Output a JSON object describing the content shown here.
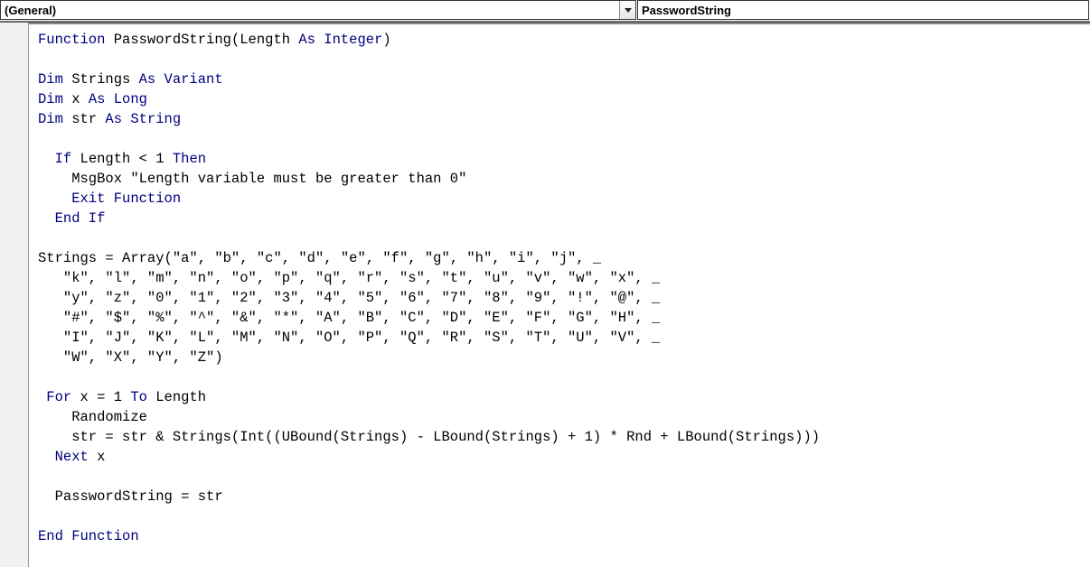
{
  "dropdowns": {
    "object": "(General)",
    "procedure": "PasswordString"
  },
  "code": {
    "l01a": "Function",
    "l01b": " PasswordString(Length ",
    "l01c": "As Integer",
    "l01d": ")",
    "l03a": "Dim",
    "l03b": " Strings ",
    "l03c": "As Variant",
    "l04a": "Dim",
    "l04b": " x ",
    "l04c": "As Long",
    "l05a": "Dim",
    "l05b": " str ",
    "l05c": "As String",
    "l07a": "  If",
    "l07b": " Length < 1 ",
    "l07c": "Then",
    "l08": "    MsgBox \"Length variable must be greater than 0\"",
    "l09": "    Exit Function",
    "l10": "  End If",
    "l12": "Strings = Array(\"a\", \"b\", \"c\", \"d\", \"e\", \"f\", \"g\", \"h\", \"i\", \"j\", _",
    "l13": "   \"k\", \"l\", \"m\", \"n\", \"o\", \"p\", \"q\", \"r\", \"s\", \"t\", \"u\", \"v\", \"w\", \"x\", _",
    "l14": "   \"y\", \"z\", \"0\", \"1\", \"2\", \"3\", \"4\", \"5\", \"6\", \"7\", \"8\", \"9\", \"!\", \"@\", _",
    "l15": "   \"#\", \"$\", \"%\", \"^\", \"&\", \"*\", \"A\", \"B\", \"C\", \"D\", \"E\", \"F\", \"G\", \"H\", _",
    "l16": "   \"I\", \"J\", \"K\", \"L\", \"M\", \"N\", \"O\", \"P\", \"Q\", \"R\", \"S\", \"T\", \"U\", \"V\", _",
    "l17": "   \"W\", \"X\", \"Y\", \"Z\")",
    "l19a": " For",
    "l19b": " x = 1 ",
    "l19c": "To",
    "l19d": " Length",
    "l20": "    Randomize",
    "l21": "    str = str & Strings(Int((UBound(Strings) - LBound(Strings) + 1) * Rnd + LBound(Strings)))",
    "l22a": "  Next",
    "l22b": " x",
    "l24": "  PasswordString = str",
    "l26": "End Function"
  }
}
